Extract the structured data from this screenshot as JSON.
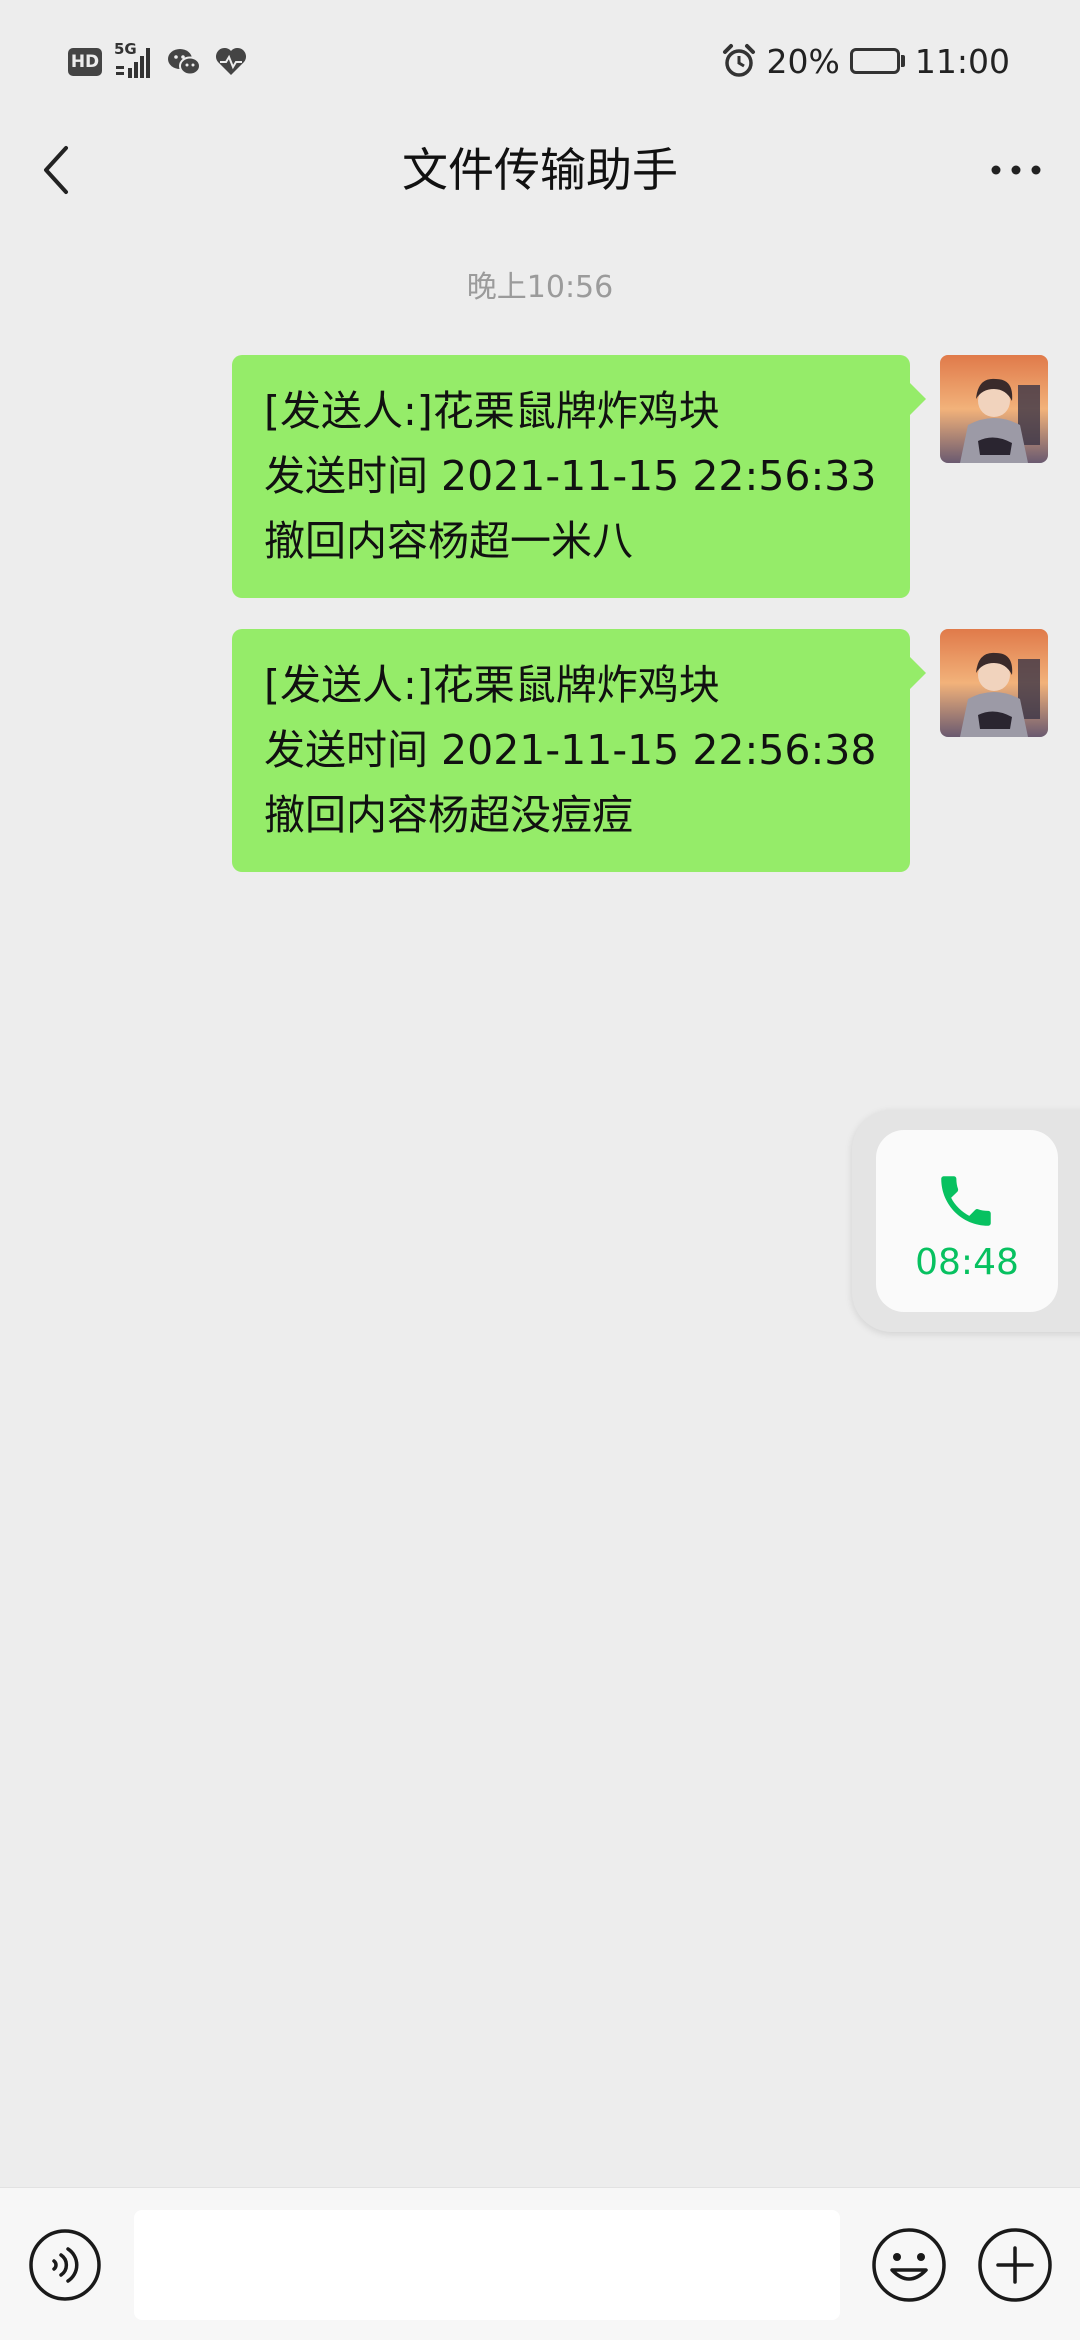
{
  "status_bar": {
    "hd_label": "HD",
    "network_label": "5G",
    "battery_percent": "20%",
    "battery_level": 0.2,
    "time": "11:00",
    "icons": [
      "signal-icon",
      "wechat-icon",
      "health-icon",
      "alarm-icon",
      "battery-icon"
    ]
  },
  "header": {
    "title": "文件传输助手",
    "back_icon": "chevron-left-icon",
    "more_icon": "more-icon"
  },
  "chat": {
    "timestamp": "晚上10:56",
    "messages": [
      {
        "lines": [
          "[发送人:]花栗鼠牌炸鸡块",
          "发送时间 2021-11-15 22:56:33",
          "撤回内容杨超一米八"
        ]
      },
      {
        "lines": [
          "[发送人:]花栗鼠牌炸鸡块",
          "发送时间 2021-11-15 22:56:38",
          "撤回内容杨超没痘痘"
        ]
      }
    ]
  },
  "call_widget": {
    "duration": "08:48",
    "icon": "phone-icon"
  },
  "input_bar": {
    "value": "",
    "placeholder": "",
    "voice_icon": "voice-icon",
    "emoji_icon": "emoji-icon",
    "plus_icon": "plus-icon"
  },
  "colors": {
    "background": "#ededed",
    "bubble": "#95ec69",
    "accent_green": "#07c160",
    "battery_fill": "#f29a1c"
  }
}
